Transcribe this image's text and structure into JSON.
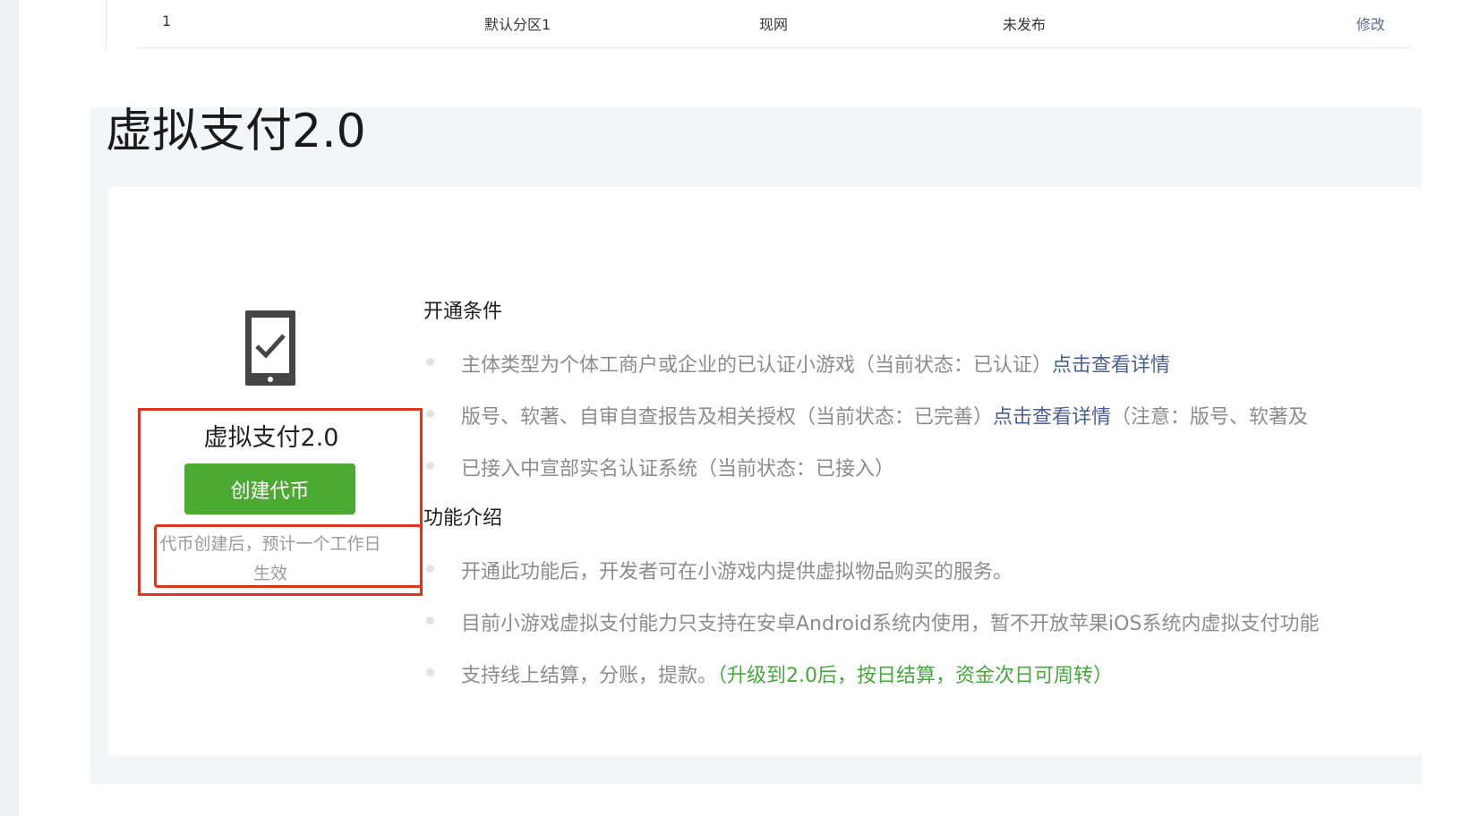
{
  "table": {
    "row": {
      "index": "1",
      "partition": "默认分区1",
      "env": "现网",
      "status": "未发布",
      "action": "修改"
    }
  },
  "section": {
    "title": "虚拟支付2.0",
    "feature": {
      "icon": "phone-check-icon",
      "name": "虚拟支付2.0",
      "button": "创建代币",
      "note": "代币创建后，预计一个工作日生效"
    },
    "conditions": {
      "heading": "开通条件",
      "items": [
        {
          "text": "主体类型为个体工商户或企业的已认证小游戏（当前状态：已认证）",
          "link": "点击查看详情"
        },
        {
          "text": "版号、软著、自审自查报告及相关授权（当前状态：已完善）",
          "link": "点击查看详情",
          "suffix": "（注意：版号、软著及"
        },
        {
          "text": "已接入中宣部实名认证系统（当前状态：已接入）"
        }
      ]
    },
    "functions": {
      "heading": "功能介绍",
      "items": [
        {
          "text": "开通此功能后，开发者可在小游戏内提供虚拟物品购买的服务。"
        },
        {
          "text": "目前小游戏虚拟支付能力只支持在安卓Android系统内使用，暂不开放苹果iOS系统内虚拟支付功能"
        },
        {
          "text": "支持线上结算，分账，提款。",
          "highlight": "（升级到2.0后，按日结算，资金次日可周转）"
        }
      ]
    }
  },
  "colors": {
    "primary_green": "#4aaa32",
    "link_blue": "#4a5f96",
    "highlight_green": "#45a83d",
    "annotation_red": "#e0341f"
  }
}
